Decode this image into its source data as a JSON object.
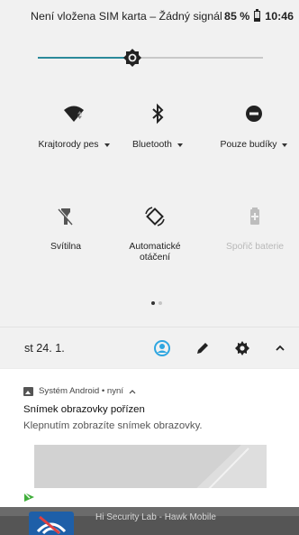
{
  "status_bar": {
    "left_text": "Není vložena SIM karta – Žádný signál",
    "battery": "85 %",
    "clock": "10:46"
  },
  "brightness": {
    "level_fraction": 0.41
  },
  "tiles": [
    {
      "icon": "wifi-icon",
      "label": "Krajtorody pes",
      "has_dropdown": true,
      "enabled": true
    },
    {
      "icon": "bluetooth-icon",
      "label": "Bluetooth",
      "has_dropdown": true,
      "enabled": true
    },
    {
      "icon": "do-not-disturb-icon",
      "label": "Pouze budíky",
      "has_dropdown": true,
      "enabled": true
    },
    {
      "icon": "flashlight-icon",
      "label": "Svítilna",
      "has_dropdown": false,
      "enabled": true
    },
    {
      "icon": "auto-rotate-icon",
      "label": "Automatické\notáčení",
      "has_dropdown": false,
      "enabled": true
    },
    {
      "icon": "battery-saver-icon",
      "label": "Spořič baterie",
      "has_dropdown": false,
      "enabled": false
    }
  ],
  "pager": {
    "current": 1,
    "total": 2
  },
  "footer": {
    "date": "st 24. 1."
  },
  "notification": {
    "app": "Systém Android • nyní",
    "title": "Snímek obrazovky pořízen",
    "text": "Klepnutím zobrazíte snímek obrazovky."
  },
  "background_app": {
    "text": "Hi Security Lab - Hawk Mobile"
  },
  "colors": {
    "accent": "#2b8a9a",
    "footer_account": "#2ea6e0",
    "play_green": "#3fae3a"
  }
}
